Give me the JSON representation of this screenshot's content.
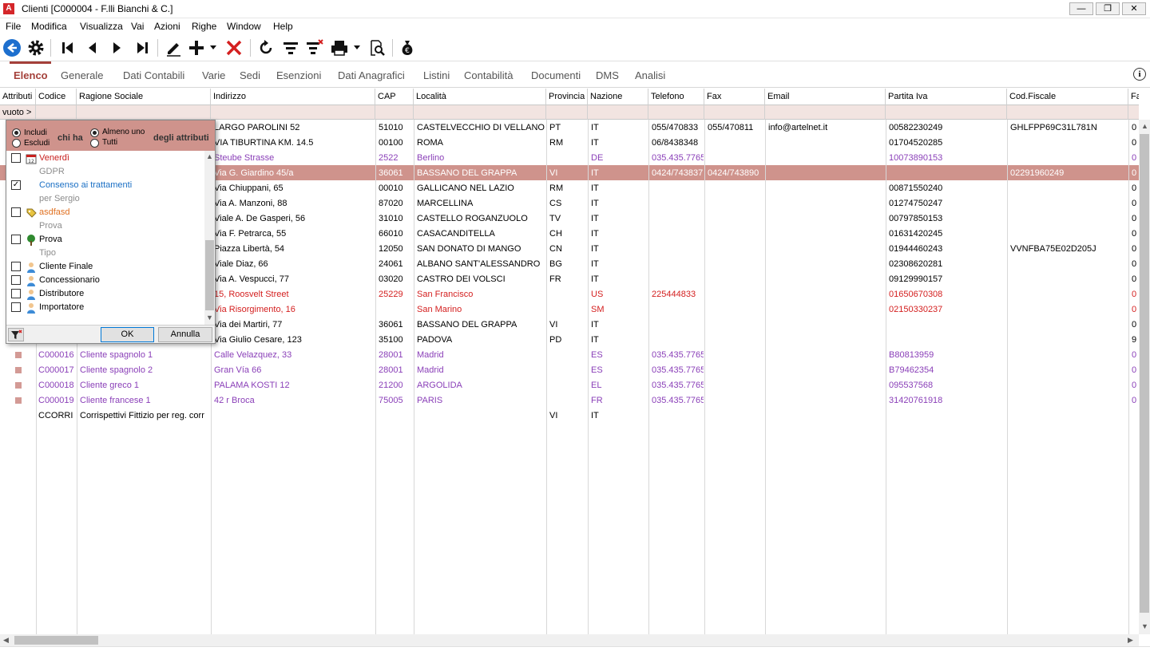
{
  "window": {
    "title": "Clienti [C000004 - F.lli Bianchi & C.]",
    "app_icon_letter": "A",
    "controls": {
      "minimize": "—",
      "restore": "❐",
      "close": "✕"
    }
  },
  "menu": [
    "File",
    "Modifica",
    "Visualizza",
    "Vai",
    "Azioni",
    "Righe",
    "Window",
    "Help"
  ],
  "toolbar": {
    "icons": [
      "back-circle-icon",
      "gear-icon",
      "first-record-icon",
      "previous-record-icon",
      "next-record-icon",
      "last-record-icon",
      "edit-pencil-icon",
      "add-plus-icon",
      "delete-x-icon",
      "refresh-icon",
      "filter-icon",
      "clear-filter-icon",
      "print-icon",
      "print-preview-icon",
      "money-bag-icon"
    ]
  },
  "tabs": [
    "Elenco",
    "Generale",
    "Dati Contabili",
    "Varie",
    "Sedi",
    "Esenzioni",
    "Dati Anagrafici",
    "Listini",
    "Contabilità",
    "Documenti",
    "DMS",
    "Analisi"
  ],
  "active_tab": "Elenco",
  "info_icon_glyph": "i",
  "grid": {
    "columns": [
      "Attributi",
      "Codice",
      "Ragione Sociale",
      "Indirizzo",
      "CAP",
      "Località",
      "Provincia",
      "Nazione",
      "Telefono",
      "Fax",
      "Email",
      "Partita Iva",
      "Cod.Fiscale",
      "Fa"
    ],
    "filter_label": "vuoto >",
    "rows": [
      {
        "style": "normal",
        "attr": false,
        "codice": "",
        "ragione": "",
        "indirizzo": "LARGO PAROLINI 52",
        "cap": "51010",
        "localita": "CASTELVECCHIO DI VELLANO",
        "prov": "PT",
        "naz": "IT",
        "tel": "055/470833",
        "fax": "055/470811",
        "email": "info@artelnet.it",
        "piva": "00582230249",
        "cf": "GHLFPP69C31L781N",
        "fa": "0"
      },
      {
        "style": "normal",
        "attr": false,
        "codice": "",
        "ragione": "",
        "indirizzo": "VIA TIBURTINA KM. 14.5",
        "cap": "00100",
        "localita": "ROMA",
        "prov": "RM",
        "naz": "IT",
        "tel": "06/8438348",
        "fax": "",
        "email": "",
        "piva": "01704520285",
        "cf": "",
        "fa": "0"
      },
      {
        "style": "purple",
        "attr": false,
        "codice": "",
        "ragione": "",
        "indirizzo": "Steube Strasse",
        "cap": "2522",
        "localita": "Berlino",
        "prov": "",
        "naz": "DE",
        "tel": "035.435.7765",
        "fax": "",
        "email": "",
        "piva": "10073890153",
        "cf": "",
        "fa": "0"
      },
      {
        "style": "sel",
        "attr": false,
        "codice": "",
        "ragione": "",
        "indirizzo": "Via G. Giardino 45/a",
        "cap": "36061",
        "localita": "BASSANO DEL GRAPPA",
        "prov": "VI",
        "naz": "IT",
        "tel": "0424/743837",
        "fax": "0424/743890",
        "email": "",
        "piva": "",
        "cf": "02291960249",
        "fa": "0"
      },
      {
        "style": "normal",
        "attr": false,
        "codice": "",
        "ragione": "",
        "indirizzo": "Via Chiuppani, 65",
        "cap": "00010",
        "localita": "GALLICANO NEL LAZIO",
        "prov": "RM",
        "naz": "IT",
        "tel": "",
        "fax": "",
        "email": "",
        "piva": "00871550240",
        "cf": "",
        "fa": "0"
      },
      {
        "style": "normal",
        "attr": false,
        "codice": "",
        "ragione": "",
        "indirizzo": "Via A. Manzoni, 88",
        "cap": "87020",
        "localita": "MARCELLINA",
        "prov": "CS",
        "naz": "IT",
        "tel": "",
        "fax": "",
        "email": "",
        "piva": "01274750247",
        "cf": "",
        "fa": "0"
      },
      {
        "style": "normal",
        "attr": false,
        "codice": "",
        "ragione": "",
        "indirizzo": "Viale A. De Gasperi, 56",
        "cap": "31010",
        "localita": "CASTELLO ROGANZUOLO",
        "prov": "TV",
        "naz": "IT",
        "tel": "",
        "fax": "",
        "email": "",
        "piva": "00797850153",
        "cf": "",
        "fa": "0"
      },
      {
        "style": "normal",
        "attr": false,
        "codice": "",
        "ragione": "",
        "indirizzo": "Via F. Petrarca, 55",
        "cap": "66010",
        "localita": "CASACANDITELLA",
        "prov": "CH",
        "naz": "IT",
        "tel": "",
        "fax": "",
        "email": "",
        "piva": "01631420245",
        "cf": "",
        "fa": "0"
      },
      {
        "style": "normal",
        "attr": false,
        "codice": "",
        "ragione": "",
        "indirizzo": "Piazza Libertà, 54",
        "cap": "12050",
        "localita": "SAN DONATO DI MANGO",
        "prov": "CN",
        "naz": "IT",
        "tel": "",
        "fax": "",
        "email": "",
        "piva": "01944460243",
        "cf": "VVNFBA75E02D205J",
        "fa": "0"
      },
      {
        "style": "normal",
        "attr": false,
        "codice": "",
        "ragione": "",
        "indirizzo": "Viale Diaz, 66",
        "cap": "24061",
        "localita": "ALBANO SANT'ALESSANDRO",
        "prov": "BG",
        "naz": "IT",
        "tel": "",
        "fax": "",
        "email": "",
        "piva": "02308620281",
        "cf": "",
        "fa": "0"
      },
      {
        "style": "normal",
        "attr": false,
        "codice": "",
        "ragione": "",
        "indirizzo": "Via A. Vespucci, 77",
        "cap": "03020",
        "localita": "CASTRO DEI VOLSCI",
        "prov": "FR",
        "naz": "IT",
        "tel": "",
        "fax": "",
        "email": "",
        "piva": "09129990157",
        "cf": "",
        "fa": "0"
      },
      {
        "style": "red",
        "attr": false,
        "codice": "",
        "ragione": "",
        "indirizzo": "15, Roosvelt Street",
        "cap": "25229",
        "localita": "San Francisco",
        "prov": "",
        "naz": "US",
        "tel": "225444833",
        "fax": "",
        "email": "",
        "piva": "01650670308",
        "cf": "",
        "fa": "0"
      },
      {
        "style": "red",
        "attr": false,
        "codice": "",
        "ragione": "",
        "indirizzo": "Via Risorgimento, 16",
        "cap": "",
        "localita": "San Marino",
        "prov": "",
        "naz": "SM",
        "tel": "",
        "fax": "",
        "email": "",
        "piva": "02150330237",
        "cf": "",
        "fa": "0"
      },
      {
        "style": "normal",
        "attr": false,
        "codice": "",
        "ragione": "",
        "indirizzo": "Via dei Martiri, 77",
        "cap": "36061",
        "localita": "BASSANO DEL GRAPPA",
        "prov": "VI",
        "naz": "IT",
        "tel": "",
        "fax": "",
        "email": "",
        "piva": "",
        "cf": "",
        "fa": "0"
      },
      {
        "style": "normal",
        "attr": false,
        "codice": "",
        "ragione": "",
        "indirizzo": "Via Giulio Cesare, 123",
        "cap": "35100",
        "localita": "PADOVA",
        "prov": "PD",
        "naz": "IT",
        "tel": "",
        "fax": "",
        "email": "",
        "piva": "",
        "cf": "",
        "fa": "9"
      },
      {
        "style": "purple",
        "attr": true,
        "codice": "C000016",
        "ragione": "Cliente spagnolo 1",
        "indirizzo": "Calle Velazquez, 33",
        "cap": "28001",
        "localita": "Madrid",
        "prov": "",
        "naz": "ES",
        "tel": "035.435.7765",
        "fax": "",
        "email": "",
        "piva": "B80813959",
        "cf": "",
        "fa": "0"
      },
      {
        "style": "purple",
        "attr": true,
        "codice": "C000017",
        "ragione": "Cliente spagnolo 2",
        "indirizzo": "Gran Vía 66",
        "cap": "28001",
        "localita": "Madrid",
        "prov": "",
        "naz": "ES",
        "tel": "035.435.7765",
        "fax": "",
        "email": "",
        "piva": "B79462354",
        "cf": "",
        "fa": "0"
      },
      {
        "style": "purple",
        "attr": true,
        "codice": "C000018",
        "ragione": "Cliente greco 1",
        "indirizzo": "PALAMA KOSTI 12",
        "cap": "21200",
        "localita": "ARGOLIDA",
        "prov": "",
        "naz": "EL",
        "tel": "035.435.7765",
        "fax": "",
        "email": "",
        "piva": "095537568",
        "cf": "",
        "fa": "0"
      },
      {
        "style": "purple",
        "attr": true,
        "codice": "C000019",
        "ragione": "Cliente francese 1",
        "indirizzo": "42 r Broca",
        "cap": "75005",
        "localita": "PARIS",
        "prov": "",
        "naz": "FR",
        "tel": "035.435.7765",
        "fax": "",
        "email": "",
        "piva": "31420761918",
        "cf": "",
        "fa": "0"
      },
      {
        "style": "normal",
        "attr": false,
        "codice": "CCORRI",
        "ragione": "Corrispettivi Fittizio per reg. corr",
        "indirizzo": "",
        "cap": "",
        "localita": "",
        "prov": "VI",
        "naz": "IT",
        "tel": "",
        "fax": "",
        "email": "",
        "piva": "",
        "cf": "",
        "fa": ""
      }
    ]
  },
  "filter_popup": {
    "include_label": "Includi",
    "exclude_label": "Escludi",
    "who_has_label": "chi ha",
    "at_least_one_label": "Almeno uno",
    "all_label": "Tutti",
    "of_attributes_label": "degli attributi",
    "items": [
      {
        "type": "item",
        "label": "Venerdì",
        "checked": false,
        "color": "#c8201e",
        "icon": "calendar-icon"
      },
      {
        "type": "group",
        "label": "GDPR"
      },
      {
        "type": "item",
        "label": "Consenso ai trattamenti",
        "checked": true,
        "color": "#1a6fc4",
        "icon": ""
      },
      {
        "type": "group",
        "label": "per Sergio"
      },
      {
        "type": "item",
        "label": "asdfasd",
        "checked": false,
        "color": "#e07020",
        "icon": "tag-icon"
      },
      {
        "type": "group",
        "label": "Prova"
      },
      {
        "type": "item",
        "label": "Prova",
        "checked": false,
        "color": "#000000",
        "icon": "tree-icon"
      },
      {
        "type": "group",
        "label": "Tipo"
      },
      {
        "type": "item",
        "label": "Cliente Finale",
        "checked": false,
        "color": "#000000",
        "icon": "user-icon"
      },
      {
        "type": "item",
        "label": "Concessionario",
        "checked": false,
        "color": "#000000",
        "icon": "user-icon"
      },
      {
        "type": "item",
        "label": "Distributore",
        "checked": false,
        "color": "#000000",
        "icon": "user-icon"
      },
      {
        "type": "item",
        "label": "Importatore",
        "checked": false,
        "color": "#000000",
        "icon": "user-icon"
      }
    ],
    "ok_label": "OK",
    "cancel_label": "Annulla"
  },
  "colors": {
    "accent": "#a4403a",
    "selected_row": "#cf938c",
    "purple_text": "#8a3fb8",
    "red_text": "#d42020"
  }
}
